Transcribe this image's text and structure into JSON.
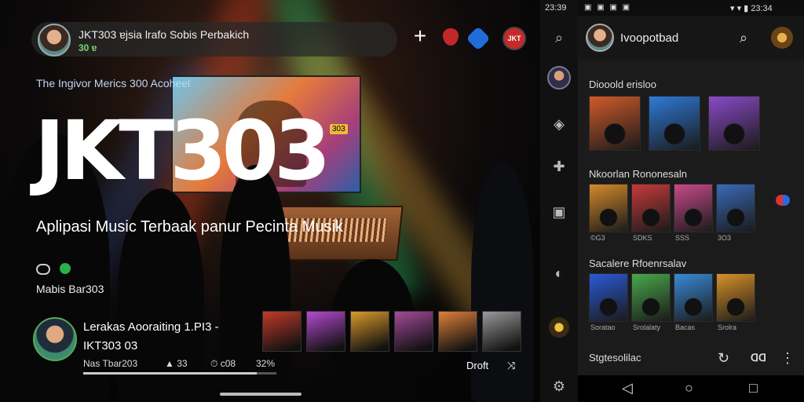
{
  "hero": {
    "top_title": "JKT303 ɐjsia lrafo Sobis Perbakich",
    "top_sub": "30 ɐ",
    "profile_badge": "JKT",
    "tagline": "The Ingivor Merics 300 Acoheel",
    "brand": "JKT303",
    "brand_badge": "303",
    "subtitle": "Aplipasi Music Terbaak panur Pecinta Musik",
    "app_label": "Mabis Bar303"
  },
  "now_playing": {
    "title": "Lerakas Aooraiting 1.PI3 -",
    "artist": "IKT303 03",
    "meta": "Nas Tbar203",
    "plays": "33",
    "time": "c08",
    "percent": "32%",
    "progress": 0.9,
    "action": "Droft",
    "thumb_colors": [
      "#c23a2a",
      "#b54ad0",
      "#d99a2a",
      "#a44a9a",
      "#e0803a",
      "#9a9a9a"
    ]
  },
  "rail": {
    "time": "23:39",
    "icons": [
      "search-icon",
      "location-icon",
      "extension-icon",
      "library-icon",
      "chat-icon",
      "settings-icon"
    ]
  },
  "status": {
    "icons": "▣ ▣ ▣ ▣",
    "right": "▾ ▾ ▮ 23:34"
  },
  "panel": {
    "title": "Ivoopotbad",
    "sections": [
      {
        "title": "Diooold erisloo",
        "covers": [
          "#d05a2a",
          "#2e7ad8",
          "#8a4ac8"
        ],
        "captions": [
          "",
          "",
          ""
        ]
      },
      {
        "title": "Nkoorlan Rononesaln",
        "covers": [
          "#d48a2a",
          "#c83a3a",
          "#c84a8a",
          "#3a6ab8"
        ],
        "captions": [
          "©G3",
          "SDKS",
          "SSS",
          "3O3"
        ]
      },
      {
        "title": "Sacalere Rfoenrsalav",
        "covers": [
          "#2a5ad8",
          "#4aa84a",
          "#3a8ad8",
          "#d8902a"
        ],
        "captions": [
          "Soratao",
          "Srolalaty",
          "Bacas",
          "Srolra"
        ]
      }
    ],
    "footer": "Stgtesolilac",
    "cast": "ᗡᗡ"
  },
  "colors": {
    "accent": "#28b04a",
    "panel": "#1b1b1b"
  }
}
